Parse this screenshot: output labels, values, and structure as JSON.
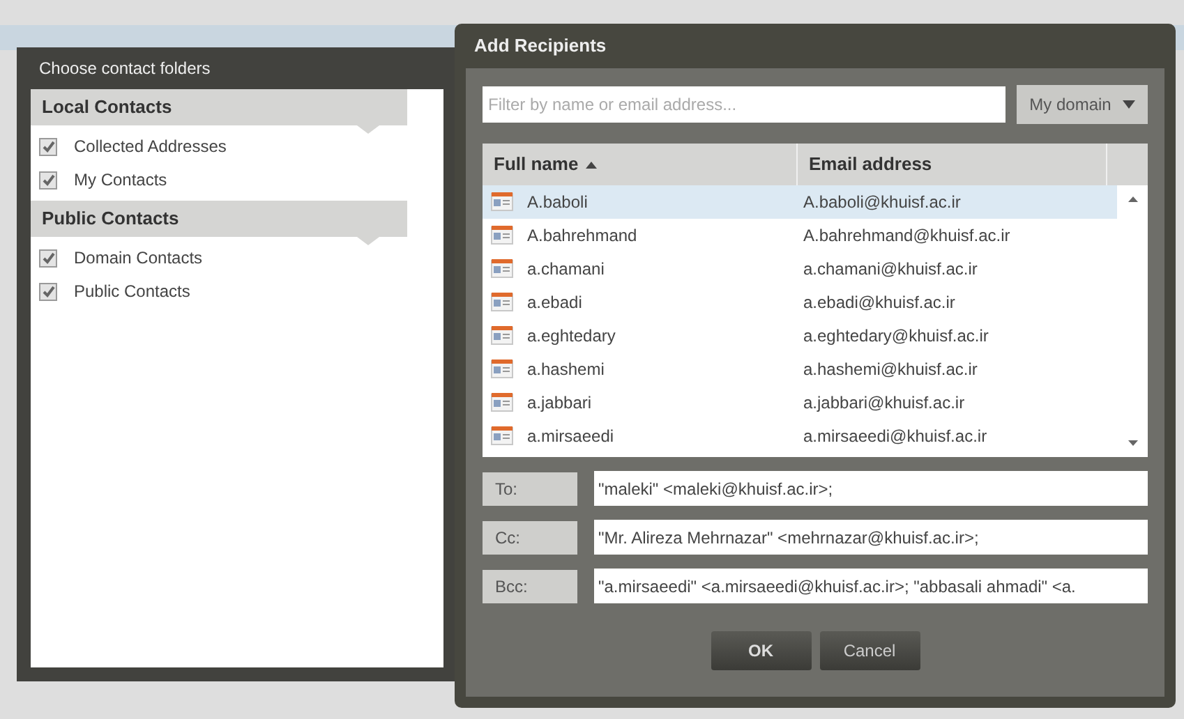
{
  "folders_panel": {
    "title": "Choose contact folders",
    "sections": [
      {
        "title": "Local Contacts",
        "items": [
          {
            "label": "Collected Addresses",
            "checked": true
          },
          {
            "label": "My Contacts",
            "checked": true
          }
        ]
      },
      {
        "title": "Public Contacts",
        "items": [
          {
            "label": "Domain Contacts",
            "checked": true
          },
          {
            "label": "Public Contacts",
            "checked": true
          }
        ]
      }
    ]
  },
  "dialog": {
    "title": "Add Recipients",
    "filter": {
      "placeholder": "Filter by name or email address..."
    },
    "scope_dropdown": "My domain",
    "table": {
      "columns": [
        {
          "label": "Full name",
          "sorted": true
        },
        {
          "label": "Email address",
          "sorted": false
        }
      ],
      "rows": [
        {
          "name": "A.baboli",
          "email": "A.baboli@khuisf.ac.ir",
          "selected": true
        },
        {
          "name": "A.bahrehmand",
          "email": "A.bahrehmand@khuisf.ac.ir",
          "selected": false
        },
        {
          "name": "a.chamani",
          "email": "a.chamani@khuisf.ac.ir",
          "selected": false
        },
        {
          "name": "a.ebadi",
          "email": "a.ebadi@khuisf.ac.ir",
          "selected": false
        },
        {
          "name": "a.eghtedary",
          "email": "a.eghtedary@khuisf.ac.ir",
          "selected": false
        },
        {
          "name": "a.hashemi",
          "email": "a.hashemi@khuisf.ac.ir",
          "selected": false
        },
        {
          "name": "a.jabbari",
          "email": "a.jabbari@khuisf.ac.ir",
          "selected": false
        },
        {
          "name": "a.mirsaeedi",
          "email": "a.mirsaeedi@khuisf.ac.ir",
          "selected": false
        }
      ]
    },
    "recipients": [
      {
        "label": "To:",
        "value": "\"maleki\" <maleki@khuisf.ac.ir>;"
      },
      {
        "label": "Cc:",
        "value": "\"Mr. Alireza Mehrnazar\" <mehrnazar@khuisf.ac.ir>;"
      },
      {
        "label": "Bcc:",
        "value": "\"a.mirsaeedi\" <a.mirsaeedi@khuisf.ac.ir>; \"abbasali ahmadi\" <a."
      }
    ],
    "buttons": [
      "OK",
      "Cancel"
    ]
  }
}
